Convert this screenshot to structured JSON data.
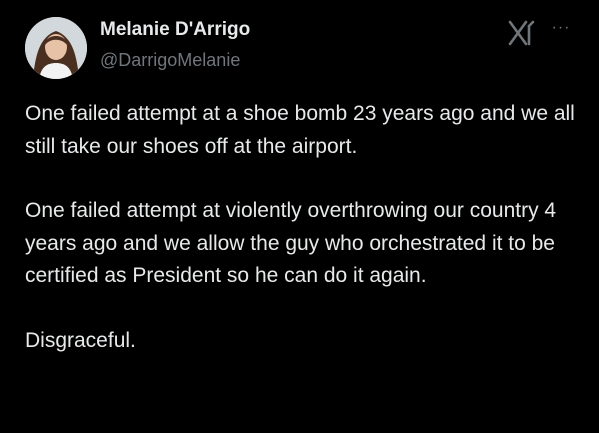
{
  "author": {
    "display_name": "Melanie D'Arrigo",
    "handle": "@DarrigoMelanie"
  },
  "icons": {
    "brand": "x-logo-icon",
    "menu": "more-options-icon"
  },
  "menu_label": "···",
  "post": {
    "paragraphs": [
      "One failed attempt at a shoe bomb 23 years ago and we all still take our shoes off at the airport.",
      "One failed attempt at violently overthrowing our country 4 years ago and we allow the guy who orchestrated it to be certified as President so he can do it again.",
      "Disgraceful."
    ]
  },
  "colors": {
    "background": "#000000",
    "primary_text": "#e7e9ea",
    "secondary_text": "#71767b"
  }
}
